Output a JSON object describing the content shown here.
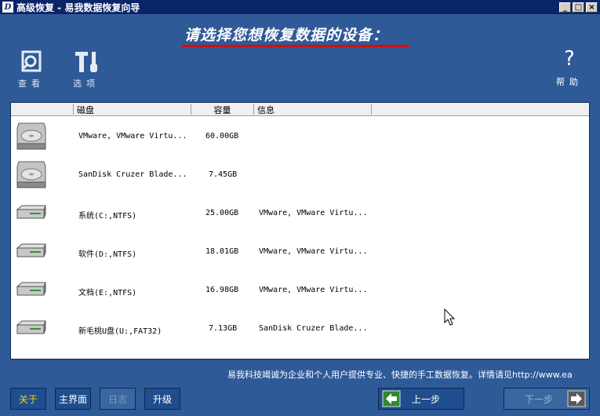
{
  "window": {
    "title": "高级恢复 - 易我数据恢复向导",
    "buttons": [
      "_",
      "□",
      "×"
    ]
  },
  "header": {
    "prompt": "请选择您想恢复数据的设备：",
    "tools_left": [
      {
        "label": "查看",
        "icon": "view-icon"
      },
      {
        "label": "选项",
        "icon": "tools-icon"
      }
    ],
    "help": {
      "label": "帮助",
      "icon": "question-icon",
      "glyph": "?"
    }
  },
  "table": {
    "columns": [
      "",
      "磁盘",
      "容量",
      "信息",
      ""
    ],
    "rows": [
      {
        "icon": "hard-disk-icon",
        "name": "VMware, VMware Virtu...",
        "size": "60.00GB",
        "info": ""
      },
      {
        "icon": "hard-disk-icon",
        "name": "SanDisk Cruzer Blade...",
        "size": "7.45GB",
        "info": ""
      },
      {
        "icon": "partition-icon",
        "name": "系统(C:,NTFS)",
        "size": "25.00GB",
        "info": "VMware, VMware Virtu..."
      },
      {
        "icon": "partition-icon",
        "name": "软件(D:,NTFS)",
        "size": "18.01GB",
        "info": "VMware, VMware Virtu..."
      },
      {
        "icon": "partition-icon",
        "name": "文档(E:,NTFS)",
        "size": "16.98GB",
        "info": "VMware, VMware Virtu..."
      },
      {
        "icon": "partition-icon",
        "name": "新毛桃U盘(U:,FAT32)",
        "size": "7.13GB",
        "info": "SanDisk Cruzer Blade..."
      }
    ]
  },
  "footer": {
    "marquee": "易我科技竭诚为企业和个人用户提供专业、快捷的手工数据恢复。详情请见http://www.ea",
    "buttons": [
      "关于",
      "主界面",
      "日志",
      "升级"
    ],
    "prev_label": "上一步",
    "next_label": "下一步"
  }
}
